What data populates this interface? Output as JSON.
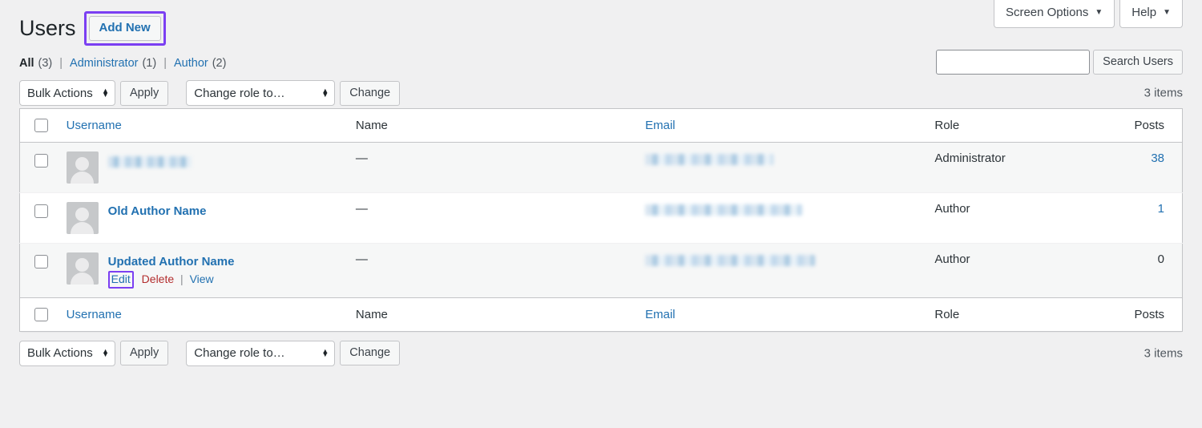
{
  "screen_meta": {
    "screen_options_label": "Screen Options",
    "help_label": "Help",
    "caret": "▼"
  },
  "header": {
    "page_title": "Users",
    "add_new_label": "Add New"
  },
  "filters": [
    {
      "label": "All",
      "count": "(3)",
      "current": true
    },
    {
      "label": "Administrator",
      "count": "(1)",
      "current": false
    },
    {
      "label": "Author",
      "count": "(2)",
      "current": false
    }
  ],
  "filter_separator": "|",
  "search": {
    "value": "",
    "placeholder": "",
    "button_label": "Search Users"
  },
  "tablenav_top": {
    "bulk_actions_value": "Bulk Actions",
    "apply_label": "Apply",
    "change_role_value": "Change role to…",
    "change_label": "Change",
    "displaying_num": "3 items"
  },
  "tablenav_bottom": {
    "bulk_actions_value": "Bulk Actions",
    "apply_label": "Apply",
    "change_role_value": "Change role to…",
    "change_label": "Change",
    "displaying_num": "3 items"
  },
  "table": {
    "columns": {
      "username": "Username",
      "name": "Name",
      "email": "Email",
      "role": "Role",
      "posts": "Posts"
    },
    "rows": [
      {
        "username_redacted": true,
        "username": "",
        "name": "—",
        "email_redacted": true,
        "email": "",
        "role": "Administrator",
        "posts": "38",
        "posts_is_link": true,
        "has_row_actions": false
      },
      {
        "username_redacted": false,
        "username": "Old Author Name",
        "name": "—",
        "email_redacted": true,
        "email": "",
        "role": "Author",
        "posts": "1",
        "posts_is_link": true,
        "has_row_actions": false
      },
      {
        "username_redacted": false,
        "username": "Updated Author Name",
        "name": "—",
        "email_redacted": true,
        "email": "",
        "role": "Author",
        "posts": "0",
        "posts_is_link": false,
        "has_row_actions": true
      }
    ],
    "row_actions": {
      "edit": "Edit",
      "delete": "Delete",
      "view": "View",
      "separator": "|"
    }
  },
  "highlights": {
    "accent_color": "#7b3ff2",
    "link_color": "#2271b1",
    "delete_color": "#b32d2e"
  }
}
